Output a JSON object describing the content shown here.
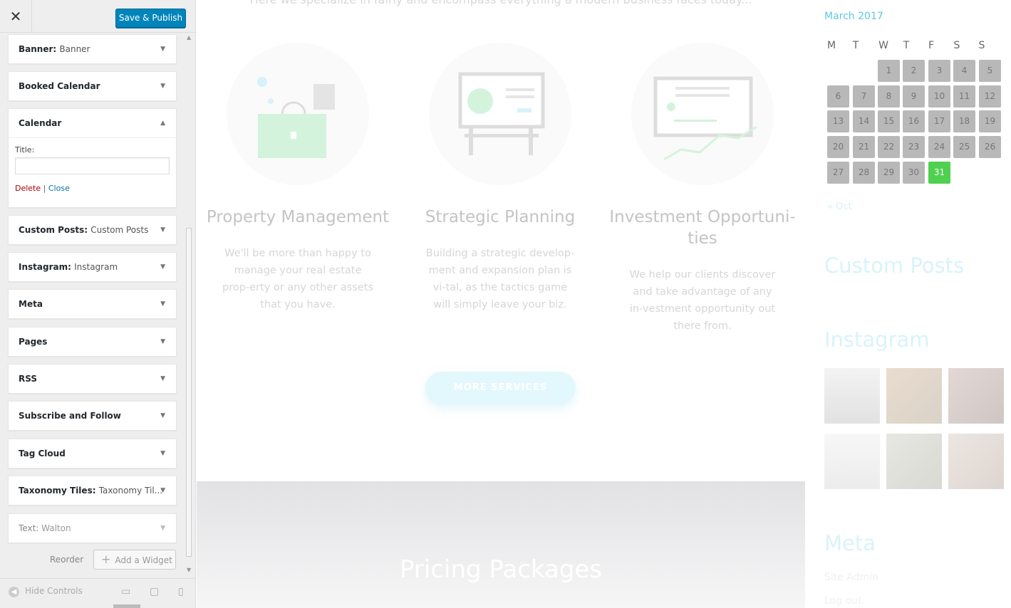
{
  "customizer": {
    "close_icon": "close-icon",
    "save_label": "Save & Publish",
    "widgets": [
      {
        "title": "Banner:",
        "sub": "Banner"
      },
      {
        "title": "Booked Calendar",
        "sub": ""
      },
      {
        "title": "Calendar",
        "sub": "",
        "expanded": true
      },
      {
        "title": "Custom Posts:",
        "sub": "Custom Posts"
      },
      {
        "title": "Instagram:",
        "sub": "Instagram"
      },
      {
        "title": "Meta",
        "sub": ""
      },
      {
        "title": "Pages",
        "sub": ""
      },
      {
        "title": "RSS",
        "sub": ""
      },
      {
        "title": "Subscribe and Follow",
        "sub": ""
      },
      {
        "title": "Tag Cloud",
        "sub": ""
      },
      {
        "title": "Taxonomy Tiles:",
        "sub": "Taxonomy Til..."
      },
      {
        "title": "Text:",
        "sub": "Walton"
      }
    ],
    "calendar_form": {
      "title_label": "Title:",
      "title_value": "",
      "delete_label": "Delete",
      "separator": "|",
      "close_label": "Close"
    },
    "reorder_label": "Reorder",
    "add_widget_label": "Add a Widget",
    "hide_controls_label": "Hide Controls"
  },
  "preview": {
    "top_text": "Here we specialize in fairly and encompass everything a modern business faces today...",
    "services": [
      {
        "title": "Property Management",
        "body": "We'll be more than happy to manage your real estate prop-erty or any other assets that you have."
      },
      {
        "title": "Strategic Planning",
        "body": "Building a strategic develop-ment and expansion plan is vi-tal, as the tactics game will simply leave your biz."
      },
      {
        "title": "Investment Opportuni-ties",
        "body": "We help our clients discover and take advantage of any in-vestment opportunity out there from."
      }
    ],
    "more_button": "MORE SERVICES",
    "pricing_title": "Pricing Packages"
  },
  "sidebar": {
    "calendar_title": "March 2017",
    "weekdays": [
      "M",
      "T",
      "W",
      "T",
      "F",
      "S",
      "S"
    ],
    "days": [
      "1",
      "2",
      "3",
      "4",
      "5",
      "6",
      "7",
      "8",
      "9",
      "10",
      "11",
      "12",
      "13",
      "14",
      "15",
      "16",
      "17",
      "18",
      "19",
      "20",
      "21",
      "22",
      "23",
      "24",
      "25",
      "26",
      "27",
      "28",
      "29",
      "30",
      "31"
    ],
    "today": "31",
    "prev_link": "« Oct",
    "custom_posts_heading": "Custom Posts",
    "instagram_heading": "Instagram",
    "meta_heading": "Meta",
    "meta_links": [
      "Site Admin",
      "Log out"
    ]
  },
  "colors": {
    "accent": "#0085ba",
    "calendar_title": "#5ec8e3",
    "today": "#4fd04f",
    "day_cell": "#b8b8b8"
  }
}
